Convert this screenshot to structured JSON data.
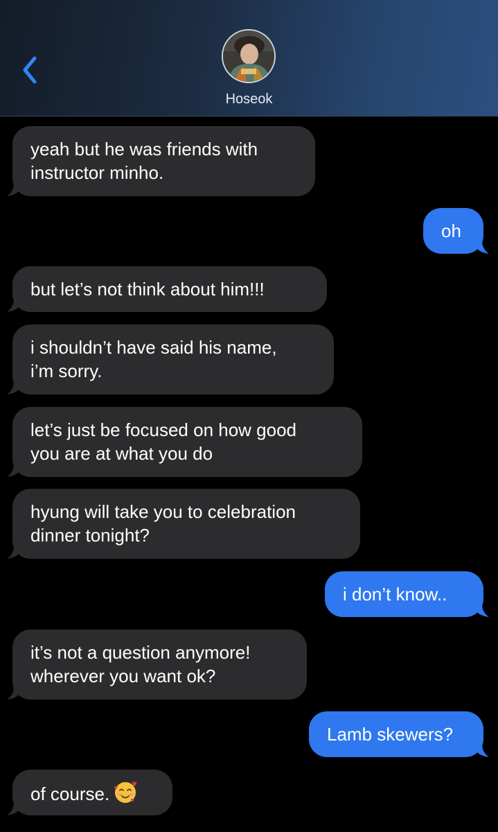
{
  "header": {
    "contact_name": "Hoseok",
    "back_icon": "chevron-left-icon",
    "accent": "#2f78f0"
  },
  "messages": [
    {
      "from": "contact",
      "text": "yeah but he was friends with\ninstructor minho."
    },
    {
      "from": "me",
      "text": "oh"
    },
    {
      "from": "contact",
      "text": "but let’s not think about him!!!"
    },
    {
      "from": "contact",
      "text": "i shouldn’t have said his name,\ni’m sorry."
    },
    {
      "from": "contact",
      "text": "let’s just be focused on how good\nyou are at what you do"
    },
    {
      "from": "contact",
      "text": "hyung will take you to celebration\ndinner tonight?"
    },
    {
      "from": "me",
      "text": "i don’t know.."
    },
    {
      "from": "contact",
      "text": "it’s not a question anymore!\nwherever you want ok?"
    },
    {
      "from": "me",
      "text": "Lamb skewers?"
    },
    {
      "from": "contact",
      "text": "of course.",
      "emoji": "smiling-face-with-hearts-icon"
    }
  ],
  "colors": {
    "incoming_bubble": "#2c2c2e",
    "outgoing_bubble": "#2f78f0",
    "background": "#000000"
  }
}
